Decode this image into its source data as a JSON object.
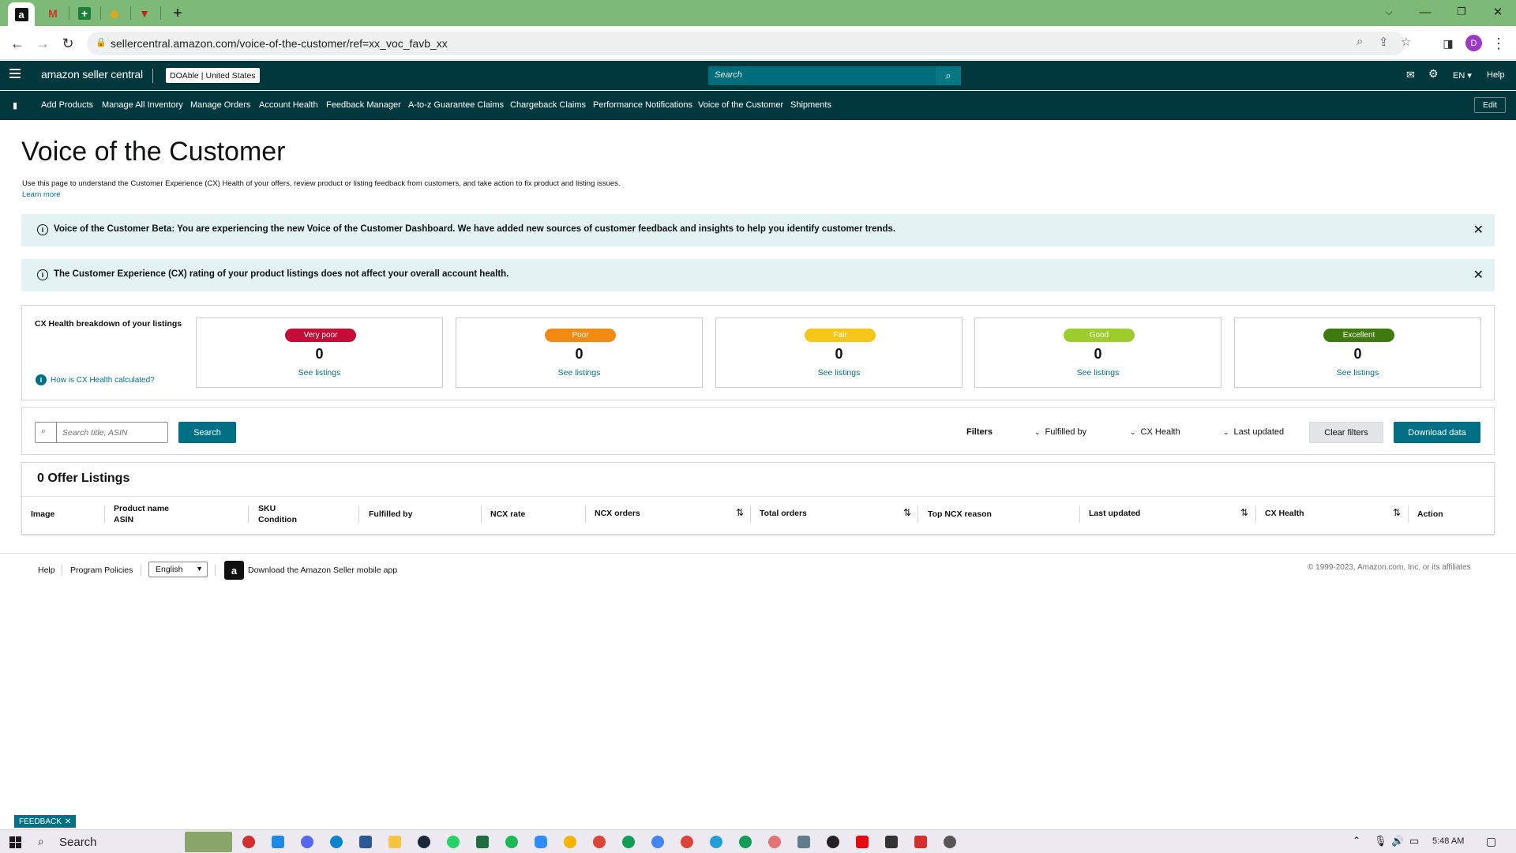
{
  "browser": {
    "tabs": [
      {
        "icon": "amazon-icon",
        "glyph": "a"
      },
      {
        "icon": "gmail-icon",
        "glyph": "M"
      },
      {
        "icon": "sheets-icon",
        "glyph": "+"
      },
      {
        "icon": "app-icon",
        "glyph": "◆"
      },
      {
        "icon": "vpn-icon",
        "glyph": "▼"
      }
    ],
    "new_tab": "+",
    "url": "sellercentral.amazon.com/voice-of-the-customer/ref=xx_voc_favb_xx",
    "profile_initial": "D"
  },
  "header": {
    "logo": "amazon seller central",
    "account": "DOAble",
    "marketplace": "United States",
    "search_placeholder": "Search",
    "lang": "EN",
    "help": "Help"
  },
  "nav": {
    "links": [
      "Add Products",
      "Manage All Inventory",
      "Manage Orders",
      "Account Health",
      "Feedback Manager",
      "A-to-z Guarantee Claims",
      "Chargeback Claims",
      "Performance Notifications",
      "Voice of the Customer",
      "Shipments"
    ],
    "edit": "Edit"
  },
  "page": {
    "title": "Voice of the Customer",
    "description": "Use this page to understand the Customer Experience (CX) Health of your offers, review product or listing feedback from customers, and take action to fix product and listing issues.",
    "learn_more": "Learn more"
  },
  "alerts": [
    "Voice of the Customer Beta: You are experiencing the new Voice of the Customer Dashboard. We have added new sources of customer feedback and insights to help you identify customer trends.",
    "The Customer Experience (CX) rating of your product listings does not affect your overall account health."
  ],
  "breakdown": {
    "title": "CX Health breakdown of your listings",
    "help_link": "How is CX Health calculated?",
    "cards": [
      {
        "label": "Very poor",
        "count": "0",
        "link": "See listings",
        "color": "#c40c37"
      },
      {
        "label": "Poor",
        "count": "0",
        "link": "See listings",
        "color": "#f08a12"
      },
      {
        "label": "Fair",
        "count": "0",
        "link": "See listings",
        "color": "#f5c518"
      },
      {
        "label": "Good",
        "count": "0",
        "link": "See listings",
        "color": "#9dcd2a"
      },
      {
        "label": "Excellent",
        "count": "0",
        "link": "See listings",
        "color": "#3f7a0e"
      }
    ]
  },
  "filters": {
    "search_placeholder": "Search title, ASIN",
    "search_btn": "Search",
    "label": "Filters",
    "fulfilled_by": "Fulfilled by",
    "cx_health": "CX Health",
    "last_updated": "Last updated",
    "clear": "Clear filters",
    "download": "Download data"
  },
  "listings": {
    "title": "0 Offer Listings",
    "columns": {
      "image": "Image",
      "product_name": "Product name",
      "asin": "ASIN",
      "sku": "SKU",
      "condition": "Condition",
      "fulfilled_by": "Fulfilled by",
      "ncx_rate": "NCX rate",
      "ncx_orders": "NCX orders",
      "total_orders": "Total orders",
      "top_reason": "Top NCX reason",
      "last_updated": "Last updated",
      "cx_health": "CX Health",
      "action": "Action"
    }
  },
  "footer": {
    "help": "Help",
    "policies": "Program Policies",
    "language": "English",
    "app": "Download the Amazon Seller mobile app",
    "copyright": "© 1999-2023, Amazon.com, Inc. or its affiliates"
  },
  "feedback": "FEEDBACK",
  "taskbar": {
    "search": "Search",
    "time": "5:48 AM"
  }
}
